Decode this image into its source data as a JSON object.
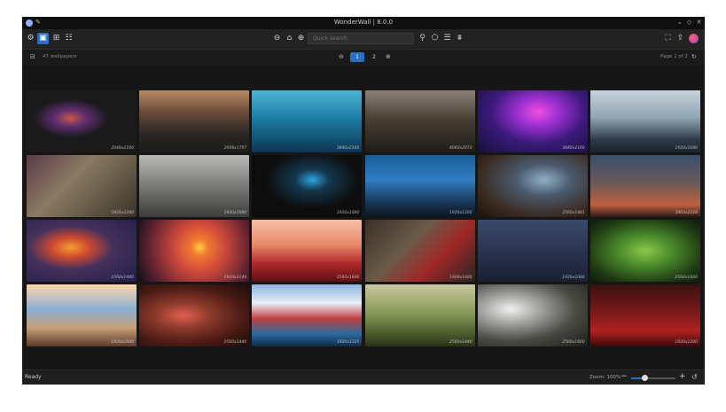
{
  "window": {
    "title": "WonderWall | 8.0.0",
    "controls": [
      "⌄",
      "◇",
      "✕"
    ]
  },
  "toolbar": {
    "left_icons": [
      {
        "name": "settings-icon",
        "glyph": "⚙"
      },
      {
        "name": "gallery-icon",
        "glyph": "▣",
        "active": true
      },
      {
        "name": "bookmark-icon",
        "glyph": "⊞"
      },
      {
        "name": "tasks-icon",
        "glyph": "☷"
      }
    ],
    "center_left_icons": [
      {
        "name": "back-icon",
        "glyph": "⊖"
      },
      {
        "name": "home-icon",
        "glyph": "⌂"
      },
      {
        "name": "forward-icon",
        "glyph": "⊕"
      }
    ],
    "search_placeholder": "Quick search",
    "center_right_icons": [
      {
        "name": "search-icon",
        "glyph": "⚲"
      },
      {
        "name": "tag-icon",
        "glyph": "⬠"
      },
      {
        "name": "sliders-icon",
        "glyph": "☰"
      },
      {
        "name": "filter-icon",
        "glyph": "⩩"
      }
    ],
    "right_icons": [
      {
        "name": "fullscreen-icon",
        "glyph": "⛶"
      },
      {
        "name": "upload-icon",
        "glyph": "⇪"
      }
    ],
    "accent": "#2d6fbf"
  },
  "subbar": {
    "count_label": "47 wallpapers",
    "pages": [
      "1",
      "2"
    ],
    "active_page": "1",
    "page_label": "Page 1 of 2"
  },
  "wallpapers": [
    {
      "res": "2048x2160",
      "bg": "radial-gradient(ellipse at 40% 45%,#c8564a 0,#5b2d6e 18%,#1a1a1a 40%)"
    },
    {
      "res": "2098x1797",
      "bg": "linear-gradient(180deg,#b78a62 0%,#6c4a3a 35%,#2a2826 70%,#1a1a18 100%)"
    },
    {
      "res": "3840x2160",
      "bg": "linear-gradient(180deg,#4db4d4 0%,#1d7da4 45%,#0b3552 100%)"
    },
    {
      "res": "4060x2073",
      "bg": "linear-gradient(180deg,#8a8278 0%,#4a4036 45%,#1f1c17 100%)"
    },
    {
      "res": "3840x2160",
      "bg": "radial-gradient(ellipse at 55% 35%,#f04ee2 0,#9a2fd0 25%,#3b1a7a 55%,#14103a 100%)"
    },
    {
      "res": "1920x1080",
      "bg": "linear-gradient(180deg,#c8d4dc 0%,#8fa3b2 45%,#2c3a48 80%,#1a232c 100%)"
    },
    {
      "res": "1920x1280",
      "bg": "linear-gradient(135deg,#5a3c4a 0%,#8a7a62 40%,#3a3328 100%)"
    },
    {
      "res": "1920x1080",
      "bg": "linear-gradient(180deg,#b8b8b6 0%,#7a7a78 50%,#3c3c3a 100%)"
    },
    {
      "res": "1920x1080",
      "bg": "radial-gradient(ellipse at 55% 40%,#2fa4e0 0,#14384e 20%,#0d0d0d 55%)"
    },
    {
      "res": "1920x1200",
      "bg": "linear-gradient(180deg,#1a5d9a 0%,#2f7cc0 40%,#17324e 80%,#0a1420 100%)"
    },
    {
      "res": "2560x1441",
      "bg": "radial-gradient(ellipse at 60% 40%,#8fb0c8 0,#4a5a6c 30%,#3a2a20 70%,#1a120c 100%)"
    },
    {
      "res": "3803x2228",
      "bg": "linear-gradient(180deg,#3a4e6a 0%,#6a5a5a 45%,#c06040 80%,#2a1a18 100%)"
    },
    {
      "res": "2560x1440",
      "bg": "radial-gradient(ellipse at 40% 45%,#f0a030 0,#d04a30 20%,#46305c 45%,#1f1e4a 100%)"
    },
    {
      "res": "1920x2144",
      "bg": "radial-gradient(circle at 55% 45%,#ffcf40 0,#f07a30 12%,#d04a3c 35%,#5a2030 75%,#14101c 100%)"
    },
    {
      "res": "2560x1600",
      "bg": "linear-gradient(180deg,#f4c0a8 0%,#e88a6a 40%,#b02a2a 70%,#5c0f14 100%)"
    },
    {
      "res": "1920x1080",
      "bg": "linear-gradient(135deg,#3a3028 0%,#6a5a48 40%,#a02828 65%,#2a2420 100%)"
    },
    {
      "res": "1920x1080",
      "bg": "linear-gradient(180deg,#3a4a6a 0%,#2a3450 50%,#1a2034 100%)"
    },
    {
      "res": "2560x1600",
      "bg": "radial-gradient(ellipse at 50% 50%,#8ac84a 0,#4a8a2a 35%,#1e3a14 75%,#0e1a0a 100%)"
    },
    {
      "res": "1920x1080",
      "bg": "linear-gradient(180deg,#ffd6a8 0%,#8ab0d4 40%,#c8a078 70%,#5a3a2a 100%)"
    },
    {
      "res": "2560x1440",
      "bg": "radial-gradient(ellipse at 40% 50%,#e06050 0,#8a3a2a 30%,#4a1a14 65%,#1e0c0a 100%)"
    },
    {
      "res": "1920x1325",
      "bg": "linear-gradient(180deg,#8ab4e0 0%,#e8f0f8 30%,#c04040 55%,#2a6aa0 80%,#0f2a44 100%)"
    },
    {
      "res": "2560x1440",
      "bg": "linear-gradient(180deg,#c8c8a0 0%,#8a9a5a 45%,#4a5a2a 80%,#2a3018 100%)"
    },
    {
      "res": "2560x1600",
      "bg": "radial-gradient(ellipse at 30% 40%,#f0f0f0 0,#a8a8a4 25%,#4a4a44 60%,#1c1c18 100%)"
    },
    {
      "res": "1920x1200",
      "bg": "linear-gradient(180deg,#3a1010 0%,#7a1a1a 45%,#b02020 75%,#3a0a0a 100%)"
    }
  ],
  "status": {
    "ready": "Ready",
    "zoom_label": "Zoom: 100%",
    "zoom_value": 0.3
  }
}
